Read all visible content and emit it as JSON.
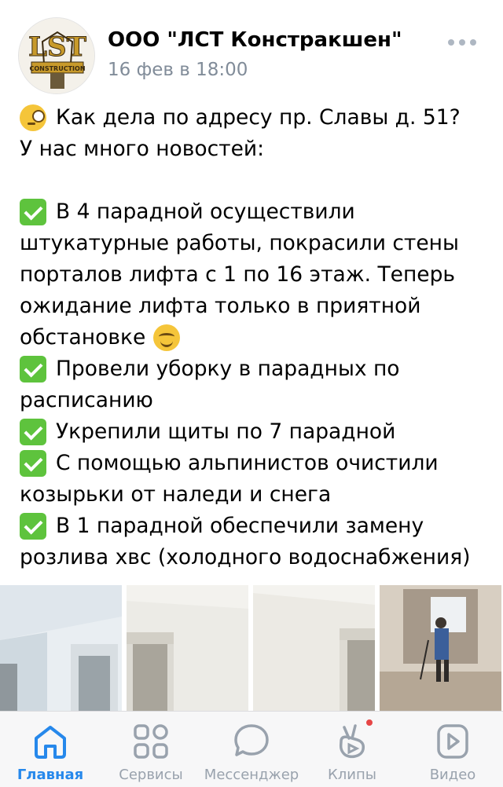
{
  "post": {
    "author": "ООО \"ЛСТ Констракшен\"",
    "date": "16 фев в 18:00",
    "avatar_text": "LST CONSTRUCTION INC.",
    "lines": [
      "Как дела по адресу пр. Славы д. 51?",
      "У нас много новостей:",
      "",
      "В 4 парадной осуществили",
      "штукатурные работы, покрасили стены",
      "порталов лифта с 1 по 16 этаж. Теперь",
      "ожидание лифта только в приятной",
      "обстановке",
      "Провели уборку в парадных по",
      "расписанию",
      "Укрепили щиты по 7 парадной",
      "С помощью альпинистов очистили",
      "козырьки от наледи и снега",
      "В 1 парадной обеспечили замену",
      "розлива хвс (холодного водоснабжения)"
    ]
  },
  "tabbar": {
    "items": [
      {
        "label": "Главная",
        "icon": "home-icon",
        "active": true
      },
      {
        "label": "Сервисы",
        "icon": "services-icon",
        "active": false
      },
      {
        "label": "Мессенджер",
        "icon": "messenger-icon",
        "active": false
      },
      {
        "label": "Клипы",
        "icon": "clips-icon",
        "active": false,
        "badge": true
      },
      {
        "label": "Видео",
        "icon": "video-icon",
        "active": false
      }
    ]
  },
  "colors": {
    "accent": "#2688eb",
    "muted": "#99a2ad",
    "date": "#818c99",
    "check": "#5ec33d",
    "badge": "#e64646"
  }
}
